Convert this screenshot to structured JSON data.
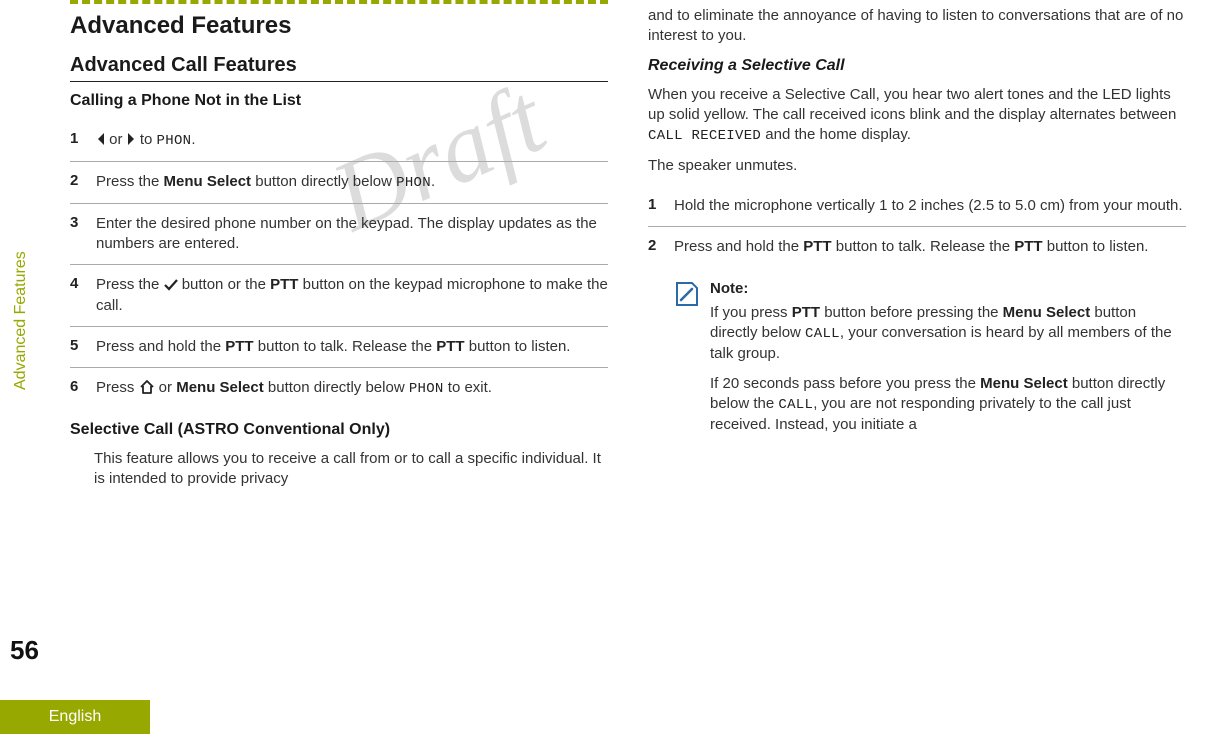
{
  "watermark": "Draft",
  "sidebar": {
    "section_label": "Advanced Features",
    "page_number": "56",
    "language": "English"
  },
  "left": {
    "h1": "Advanced Features",
    "h2": "Advanced Call Features",
    "h3a": "Calling a Phone Not in the List",
    "steps": [
      {
        "n": "1",
        "pre": "",
        "mid": " or ",
        "post": " to ",
        "code": "PHON",
        "tail": "."
      },
      {
        "n": "2",
        "pre": "Press the ",
        "bold": "Menu Select",
        "post": " button directly below ",
        "code": "PHON",
        "tail": "."
      },
      {
        "n": "3",
        "txt": "Enter the desired phone number on the keypad. The display updates as the numbers are entered."
      },
      {
        "n": "4",
        "pre": "Press the ",
        "post2": " button or the ",
        "bold": "PTT",
        "tail": " button on the keypad microphone to make the call."
      },
      {
        "n": "5",
        "pre": "Press and hold the ",
        "bold": "PTT",
        "mid": " button to talk. Release the ",
        "bold2": "PTT",
        "tail": " button to listen."
      },
      {
        "n": "6",
        "pre": "Press ",
        "mid": " or ",
        "bold": "Menu Select",
        "post": " button directly below ",
        "code": "PHON",
        "tail": " to exit."
      }
    ],
    "h3b": "Selective Call (ASTRO Conventional Only)",
    "p_intro": "This feature allows you to receive a call from or to call a specific individual. It is intended to provide privacy"
  },
  "right": {
    "p_cont": "and to eliminate the annoyance of having to listen to conversations that are of no interest to you.",
    "h3": "Receiving a Selective Call",
    "p1a": "When you receive a Selective Call, you hear two alert tones and the LED lights up solid yellow. The call received icons blink and the display alternates between ",
    "code1": "CALL RECEIVED",
    "p1b": " and the home display.",
    "p2": "The speaker unmutes.",
    "steps": [
      {
        "n": "1",
        "txt": "Hold the microphone vertically 1 to 2 inches (2.5 to 5.0 cm) from your mouth."
      },
      {
        "n": "2",
        "pre": "Press and hold the ",
        "bold": "PTT",
        "mid": " button to talk. Release the ",
        "bold2": "PTT",
        "tail": " button to listen."
      }
    ],
    "note": {
      "title": "Note:",
      "p1a": "If you press ",
      "p1b": "PTT",
      "p1c": " button before pressing the ",
      "p1d": "Menu Select",
      "p1e": " button directly below ",
      "code": "CALL",
      "p1f": ", your conversation is heard by all members of the talk group.",
      "p2a": "If 20 seconds pass before you press the ",
      "p2b": "Menu Select",
      "p2c": " button directly below the ",
      "code2": "CALL",
      "p2d": ", you are not responding privately to the call just received. Instead, you initiate a"
    }
  }
}
